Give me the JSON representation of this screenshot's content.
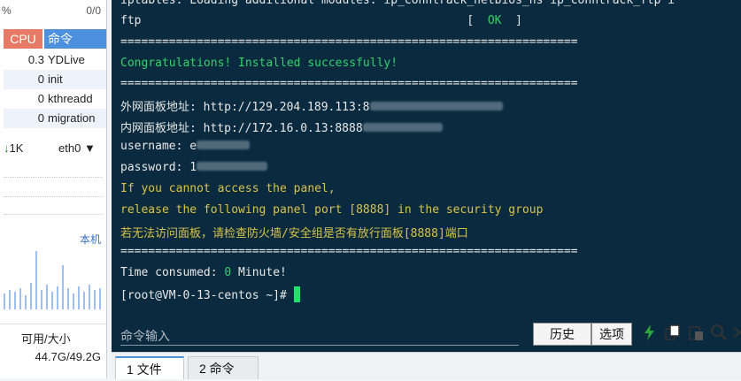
{
  "sidebar": {
    "top_left": "%",
    "top_right": "0/0",
    "process_headers": {
      "cpu": "CPU",
      "cmd": "命令"
    },
    "processes": [
      {
        "cpu": "0.3",
        "name": "YDLive"
      },
      {
        "cpu": "0",
        "name": "init"
      },
      {
        "cpu": "0",
        "name": "kthreadd"
      },
      {
        "cpu": "0",
        "name": "migration"
      }
    ],
    "net": {
      "down": "1K",
      "iface": "eth0"
    },
    "graph_label": "本机",
    "disk_header": "可用/大小",
    "disk_value": "44.7G/49.2G"
  },
  "terminal": {
    "lines": [
      {
        "text": "iptables: Loading additional modules: ip_conntrack_netbios_ns ip_conntrack_ftp i",
        "cls": "white"
      },
      {
        "text": "ftp                                               [  ",
        "cls": "white",
        "suffix": "OK",
        "suffix_cls": "green",
        "tail": "  ]"
      },
      {
        "text": "==================================================================",
        "cls": "white"
      },
      {
        "text": "Congratulations! Installed successfully!",
        "cls": "green"
      },
      {
        "text": "==================================================================",
        "cls": "white"
      },
      {
        "text": "外网面板地址: http://129.204.189.113:8",
        "cls": "white",
        "blur": 60
      },
      {
        "text": "内网面板地址: http://172.16.0.13:8888",
        "cls": "white",
        "blur": 80
      },
      {
        "text": "username: e",
        "cls": "white",
        "blur": 40
      },
      {
        "text": "password: 1",
        "cls": "white",
        "blur": 50
      },
      {
        "text": "If you cannot access the panel,",
        "cls": "yellow"
      },
      {
        "text": "release the following panel port [8888] in the security group",
        "cls": "yellow"
      },
      {
        "text": "若无法访问面板，请检查防火墙/安全组是否有放行面板[8888]端口",
        "cls": "yellow"
      },
      {
        "text": "==================================================================",
        "cls": "white"
      },
      {
        "text": "Time consumed: ",
        "cls": "white",
        "suffix": "0",
        "suffix_cls": "green",
        "tail": " Minute!"
      },
      {
        "text": "[root@VM-0-13-centos ~]# ",
        "cls": "white",
        "cursor": true
      }
    ]
  },
  "cmdbar": {
    "placeholder": "命令输入",
    "history_label": "历史",
    "options_label": "选项"
  },
  "tabs": [
    {
      "label": "1 文件",
      "active": true
    },
    {
      "label": "2 命令",
      "active": false
    }
  ],
  "colors": {
    "terminal_bg": "#0a2a3f",
    "accent": "#4d90de",
    "ok_green": "#31d36a",
    "warn_yellow": "#d8c34a"
  }
}
